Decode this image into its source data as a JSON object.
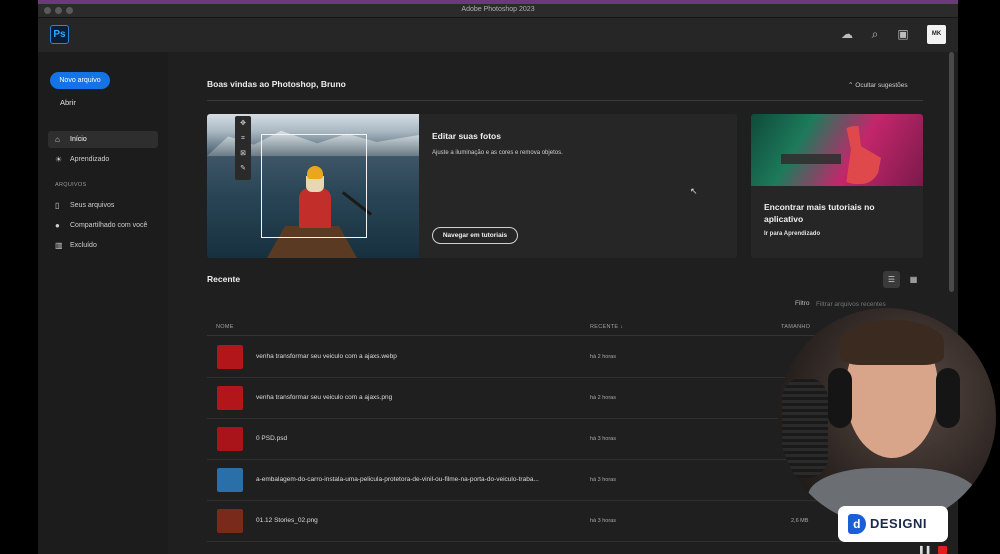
{
  "window": {
    "title": "Adobe Photoshop 2023"
  },
  "app": {
    "logo": "Ps",
    "avatar_initials": "MK"
  },
  "appbar_icons": [
    "cloud-icon",
    "search-icon",
    "gift-icon"
  ],
  "sidebar": {
    "new_file": "Novo arquivo",
    "open": "Abrir",
    "items": [
      {
        "label": "Início",
        "icon": "home-icon"
      },
      {
        "label": "Aprendizado",
        "icon": "lightbulb-icon"
      }
    ],
    "files_section": "ARQUIVOS",
    "file_items": [
      {
        "label": "Seus arquivos",
        "icon": "file-icon"
      },
      {
        "label": "Compartilhado com você",
        "icon": "shared-user-icon"
      },
      {
        "label": "Excluído",
        "icon": "trash-icon"
      }
    ]
  },
  "home": {
    "welcome": "Boas vindas ao Photoshop, Bruno",
    "hide_suggestions": "Ocultar sugestões",
    "edit_card": {
      "title": "Editar suas fotos",
      "desc": "Ajuste a iluminação e as cores e remova objetos.",
      "button": "Navegar em tutoriais"
    },
    "tutorial_card": {
      "title": "Encontrar mais tutoriais no aplicativo",
      "link": "Ir para Aprendizado"
    }
  },
  "recent": {
    "title": "Recente",
    "filter_label": "Filtro",
    "filter_placeholder": "Filtrar arquivos recentes",
    "columns": {
      "name": "NOME",
      "recent": "RECENTE",
      "size": "TAMANHO"
    },
    "files": [
      {
        "name": "venha transformar seu veiculo com a ajaxs.webp",
        "recent": "há 2 horas",
        "size": ""
      },
      {
        "name": "venha transformar seu veiculo com a ajaxs.png",
        "recent": "há 2 horas",
        "size": ""
      },
      {
        "name": "0 PSD.psd",
        "recent": "há 3 horas",
        "size": ""
      },
      {
        "name": "a-embalagem-do-carro-instala-uma-pelicula-protetora-de-vinil-ou-filme-na-porta-do-veiculo-traba...",
        "recent": "há 3 horas",
        "size": ""
      },
      {
        "name": "01.12 Stories_02.png",
        "recent": "há 3 horas",
        "size": "2,6 MB"
      }
    ],
    "thumb_colors": [
      "#b2161b",
      "#b2161b",
      "#a8141a",
      "#2a6fa8",
      "#7a2a1a"
    ]
  },
  "overlay": {
    "brand": "DESIGNI",
    "brand_mark": "d"
  }
}
